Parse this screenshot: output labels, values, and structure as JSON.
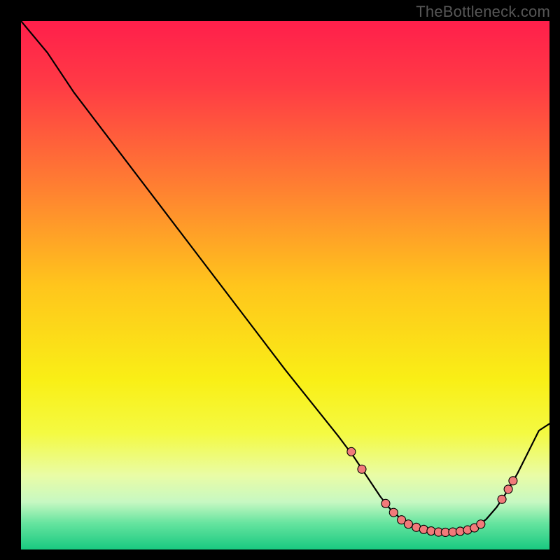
{
  "watermark": "TheBottleneck.com",
  "chart_data": {
    "type": "line",
    "title": "",
    "xlabel": "",
    "ylabel": "",
    "xlim": [
      0,
      100
    ],
    "ylim": [
      0,
      100
    ],
    "grid": false,
    "legend": false,
    "gradient_stops": [
      {
        "offset": 0.0,
        "color": "#ff1f4b"
      },
      {
        "offset": 0.12,
        "color": "#ff3a45"
      },
      {
        "offset": 0.3,
        "color": "#ff7a33"
      },
      {
        "offset": 0.5,
        "color": "#ffc51c"
      },
      {
        "offset": 0.68,
        "color": "#f9ef16"
      },
      {
        "offset": 0.78,
        "color": "#f4fa42"
      },
      {
        "offset": 0.86,
        "color": "#e9fca6"
      },
      {
        "offset": 0.91,
        "color": "#c7f8c2"
      },
      {
        "offset": 0.95,
        "color": "#66e49f"
      },
      {
        "offset": 1.0,
        "color": "#19c980"
      }
    ],
    "curve": [
      {
        "x": 0.0,
        "y": 100.0
      },
      {
        "x": 5.0,
        "y": 94.0
      },
      {
        "x": 10.0,
        "y": 86.5
      },
      {
        "x": 18.0,
        "y": 76.0
      },
      {
        "x": 26.0,
        "y": 65.5
      },
      {
        "x": 34.0,
        "y": 55.0
      },
      {
        "x": 42.0,
        "y": 44.5
      },
      {
        "x": 50.0,
        "y": 34.0
      },
      {
        "x": 56.0,
        "y": 26.5
      },
      {
        "x": 60.0,
        "y": 21.5
      },
      {
        "x": 63.0,
        "y": 17.5
      },
      {
        "x": 66.0,
        "y": 13.0
      },
      {
        "x": 68.0,
        "y": 10.0
      },
      {
        "x": 70.0,
        "y": 7.5
      },
      {
        "x": 72.0,
        "y": 5.7
      },
      {
        "x": 74.0,
        "y": 4.5
      },
      {
        "x": 76.0,
        "y": 3.7
      },
      {
        "x": 78.0,
        "y": 3.3
      },
      {
        "x": 80.0,
        "y": 3.2
      },
      {
        "x": 82.0,
        "y": 3.3
      },
      {
        "x": 84.0,
        "y": 3.6
      },
      {
        "x": 86.0,
        "y": 4.3
      },
      {
        "x": 88.0,
        "y": 5.7
      },
      {
        "x": 90.0,
        "y": 8.0
      },
      {
        "x": 92.0,
        "y": 11.0
      },
      {
        "x": 94.0,
        "y": 14.5
      },
      {
        "x": 96.0,
        "y": 18.5
      },
      {
        "x": 98.0,
        "y": 22.5
      },
      {
        "x": 100.0,
        "y": 23.8
      }
    ],
    "markers": [
      {
        "x": 62.5,
        "y": 18.5
      },
      {
        "x": 64.5,
        "y": 15.2
      },
      {
        "x": 69.0,
        "y": 8.7
      },
      {
        "x": 70.5,
        "y": 7.0
      },
      {
        "x": 72.0,
        "y": 5.6
      },
      {
        "x": 73.3,
        "y": 4.8
      },
      {
        "x": 74.8,
        "y": 4.2
      },
      {
        "x": 76.2,
        "y": 3.8
      },
      {
        "x": 77.6,
        "y": 3.5
      },
      {
        "x": 79.0,
        "y": 3.3
      },
      {
        "x": 80.3,
        "y": 3.25
      },
      {
        "x": 81.7,
        "y": 3.3
      },
      {
        "x": 83.1,
        "y": 3.45
      },
      {
        "x": 84.5,
        "y": 3.7
      },
      {
        "x": 85.8,
        "y": 4.1
      },
      {
        "x": 87.0,
        "y": 4.8
      },
      {
        "x": 91.0,
        "y": 9.5
      },
      {
        "x": 92.2,
        "y": 11.4
      },
      {
        "x": 93.1,
        "y": 13.0
      }
    ],
    "curve_style": {
      "stroke": "#000000",
      "width": 2.2
    },
    "marker_style": {
      "fill": "#f17a7a",
      "stroke": "#000000",
      "stroke_width": 1.1,
      "radius": 6.0
    }
  }
}
